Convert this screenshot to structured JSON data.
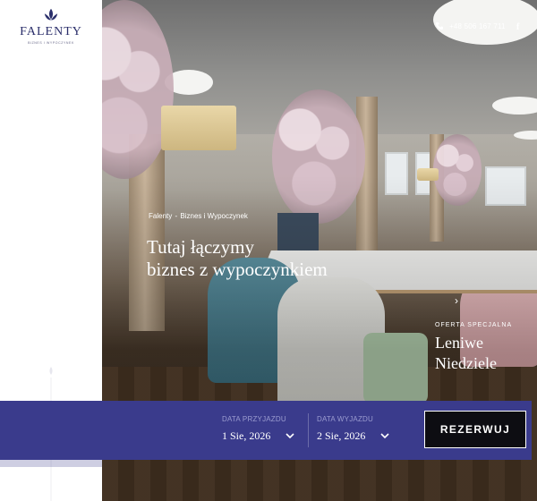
{
  "brand": {
    "name": "FALENTY",
    "tagline": "Biznes i wypoczynek",
    "accent_color": "#3a3b8c"
  },
  "header": {
    "phone": "+48 506 167 711",
    "phone_icon": "phone-icon",
    "social_icon": "facebook-icon",
    "social_label": "f"
  },
  "hero": {
    "breadcrumb": [
      "Falenty",
      "Biznes i Wypoczynek"
    ],
    "breadcrumb_separator": "-",
    "headline_line1": "Tutaj łączymy",
    "headline_line2": "biznes z wypoczynkiem"
  },
  "offer": {
    "kicker": "OFERTA SPECJALNA",
    "title_line1": "Leniwe",
    "title_line2": "Niedziele",
    "arrow": "›"
  },
  "booking": {
    "arrival_label": "DATA PRZYJAZDU",
    "arrival_value": "1 Sie, 2026",
    "departure_label": "DATA WYJAZDU",
    "departure_value": "2 Sie, 2026",
    "reserve_label": "REZERWUJ"
  }
}
